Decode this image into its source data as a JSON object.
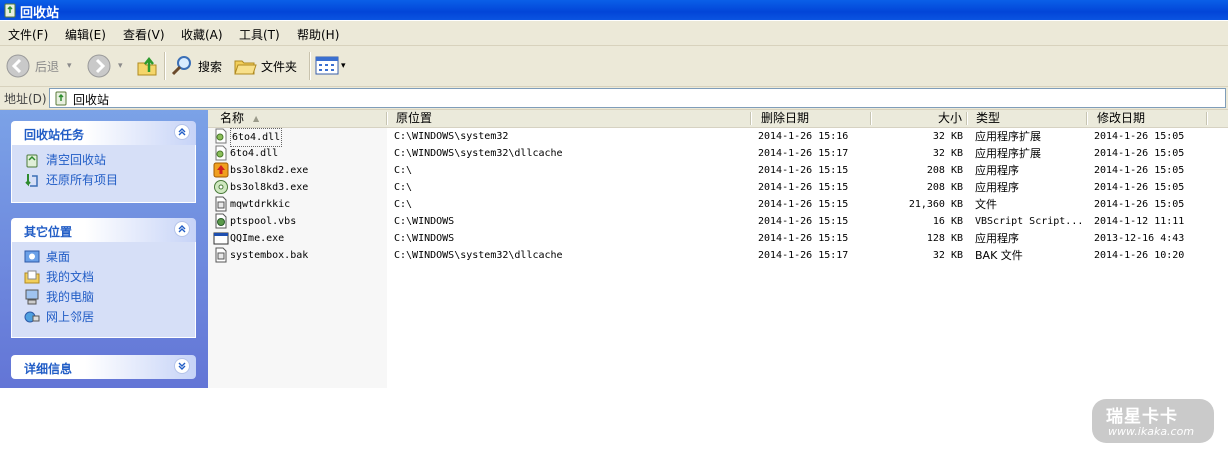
{
  "window": {
    "title": "回收站"
  },
  "menu": [
    "文件(F)",
    "编辑(E)",
    "查看(V)",
    "收藏(A)",
    "工具(T)",
    "帮助(H)"
  ],
  "toolbar": {
    "back_label": "后退",
    "search_label": "搜索",
    "folders_label": "文件夹"
  },
  "address": {
    "label": "地址(D)",
    "value": "回收站"
  },
  "tasks": {
    "recycle_title": "回收站任务",
    "recycle_items": [
      "清空回收站",
      "还原所有项目"
    ],
    "places_title": "其它位置",
    "places_items": [
      "桌面",
      "我的文档",
      "我的电脑",
      "网上邻居"
    ],
    "details_title": "详细信息"
  },
  "columns": [
    "名称",
    "原位置",
    "删除日期",
    "大小",
    "类型",
    "修改日期"
  ],
  "files": [
    {
      "name": "6to4.dll",
      "location": "C:\\WINDOWS\\system32",
      "deleted": "2014-1-26  15:16",
      "size": "32 KB",
      "type": "应用程序扩展",
      "modified": "2014-1-26 15:05",
      "icon": "dll-icon"
    },
    {
      "name": "6to4.dll",
      "location": "C:\\WINDOWS\\system32\\dllcache",
      "deleted": "2014-1-26  15:17",
      "size": "32 KB",
      "type": "应用程序扩展",
      "modified": "2014-1-26 15:05",
      "icon": "dll-icon"
    },
    {
      "name": "bs3ol8kd2.exe",
      "location": "C:\\",
      "deleted": "2014-1-26  15:15",
      "size": "208 KB",
      "type": "应用程序",
      "modified": "2014-1-26 15:05",
      "icon": "installer-icon"
    },
    {
      "name": "bs3ol8kd3.exe",
      "location": "C:\\",
      "deleted": "2014-1-26  15:15",
      "size": "208 KB",
      "type": "应用程序",
      "modified": "2014-1-26 15:05",
      "icon": "disc-icon"
    },
    {
      "name": "mqwtdrkkic",
      "location": "C:\\",
      "deleted": "2014-1-26  15:15",
      "size": "21,360 KB",
      "type": "文件",
      "modified": "2014-1-26 15:05",
      "icon": "generic-file-icon"
    },
    {
      "name": "ptspool.vbs",
      "location": "C:\\WINDOWS",
      "deleted": "2014-1-26  15:15",
      "size": "16 KB",
      "type": "VBScript Script...",
      "modified": "2014-1-12 11:11",
      "icon": "script-icon"
    },
    {
      "name": "QQIme.exe",
      "location": "C:\\WINDOWS",
      "deleted": "2014-1-26  15:15",
      "size": "128 KB",
      "type": "应用程序",
      "modified": "2013-12-16 4:43",
      "icon": "exe-window-icon"
    },
    {
      "name": "systembox.bak",
      "location": "C:\\WINDOWS\\system32\\dllcache",
      "deleted": "2014-1-26  15:17",
      "size": "32 KB",
      "type": "BAK 文件",
      "modified": "2014-1-26 10:20",
      "icon": "generic-file-icon"
    }
  ],
  "watermark": {
    "brand": "瑞星卡卡",
    "url": "www.ikaka.com"
  }
}
